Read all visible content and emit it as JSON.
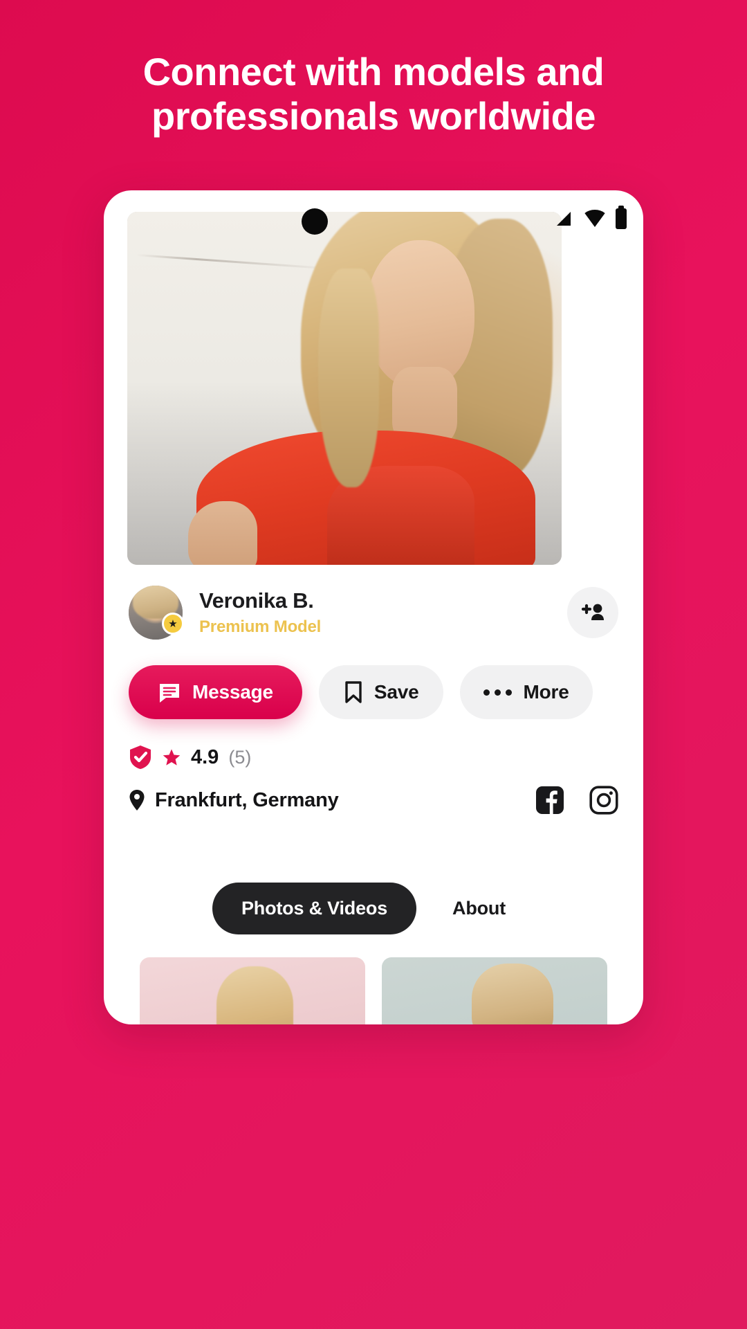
{
  "headline": {
    "line1": "Connect with models and",
    "line2": "professionals worldwide"
  },
  "colors": {
    "background_start": "#dd0b4f",
    "background_end": "#e01a5e",
    "accent": "#e61b5c",
    "premium_gold": "#ecc24f",
    "tab_active_bg": "#232325",
    "ghost_button_bg": "#f1f1f2"
  },
  "status_bar": {
    "punch_hole": "camera-punch-hole",
    "signal_icon": "signal-icon",
    "wifi_icon": "wifi-icon",
    "battery_icon": "battery-icon"
  },
  "hero": {
    "alt": "model-cover-photo"
  },
  "profile": {
    "avatar_alt": "profile-avatar-photo",
    "verified_badge_icon": "star-badge-icon",
    "name": "Veronika B.",
    "tier": "Premium Model",
    "add_button_icon": "add-person-icon"
  },
  "actions": [
    {
      "id": "message",
      "label": "Message",
      "icon": "chat-bubble-icon",
      "style": "primary"
    },
    {
      "id": "save",
      "label": "Save",
      "icon": "bookmark-icon",
      "style": "ghost"
    },
    {
      "id": "more",
      "label": "More",
      "icon": "ellipsis-icon",
      "style": "ghost"
    }
  ],
  "meta": {
    "verified_icon": "shield-check-icon",
    "star_icon": "star-icon",
    "rating": "4.9",
    "review_count": "(5)",
    "location_icon": "map-pin-icon",
    "location": "Frankfurt, Germany",
    "socials": [
      {
        "id": "facebook",
        "icon": "facebook-icon"
      },
      {
        "id": "instagram",
        "icon": "instagram-icon"
      }
    ]
  },
  "tabs": [
    {
      "id": "photos-videos",
      "label": "Photos & Videos",
      "active": true
    },
    {
      "id": "about",
      "label": "About",
      "active": false
    }
  ],
  "gallery": [
    {
      "id": "photo-1",
      "alt": "gallery-photo-pink-backdrop"
    },
    {
      "id": "photo-2",
      "alt": "gallery-photo-grey-backdrop"
    }
  ]
}
